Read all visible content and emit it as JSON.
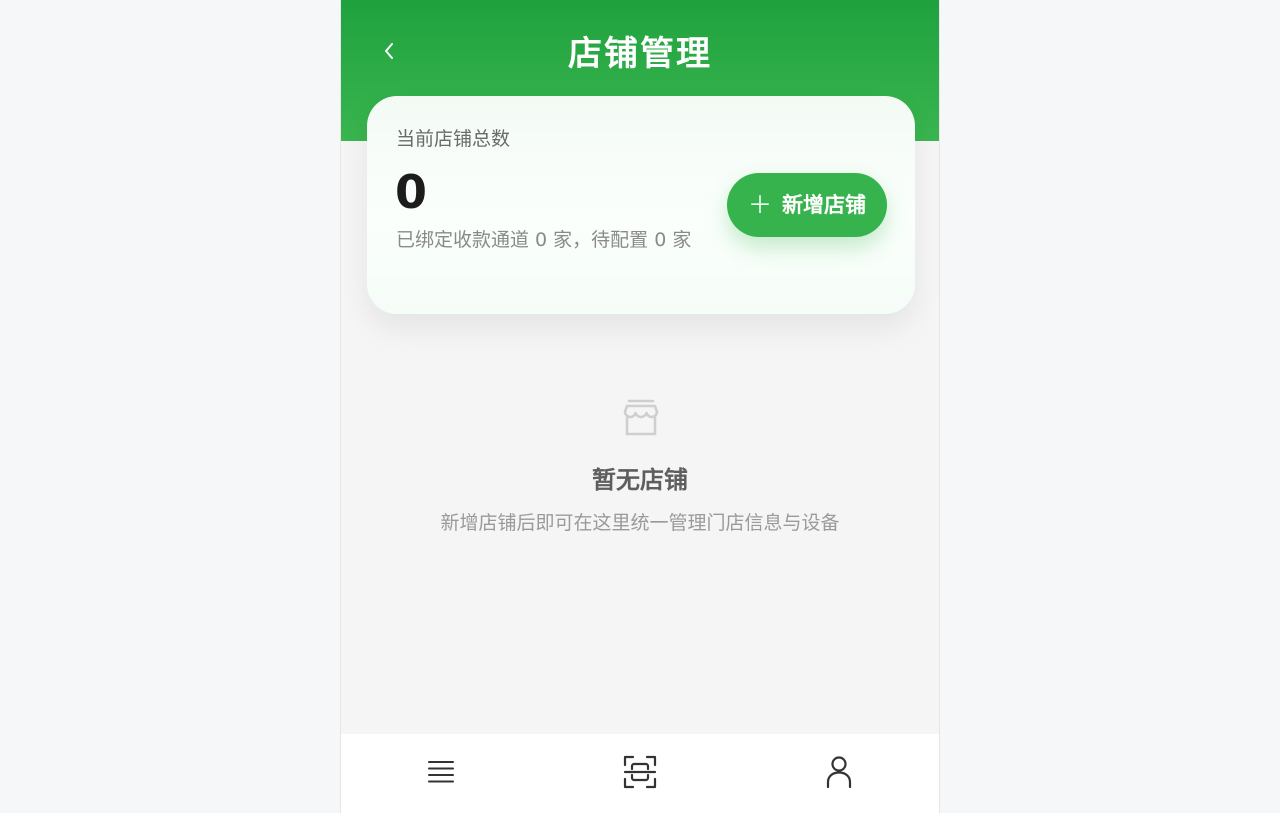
{
  "header": {
    "title": "店铺管理",
    "back_icon": "chevron-left-icon"
  },
  "summary": {
    "label": "当前店铺总数",
    "count": "0",
    "subtitle": "已绑定收款通道 0 家，待配置 0 家",
    "add_button": {
      "icon": "plus",
      "label": "新增店铺"
    }
  },
  "empty_state": {
    "icon": "store-icon",
    "title": "暂无店铺",
    "description": "新增店铺后即可在这里统一管理门店信息与设备"
  },
  "tabbar": {
    "items": [
      {
        "icon": "list-icon"
      },
      {
        "icon": "scan-icon"
      },
      {
        "icon": "user-icon"
      }
    ]
  },
  "colors": {
    "brand_green": "#36b34d",
    "header_green_top": "#1fa23e",
    "header_green_bottom": "#3ab54f"
  }
}
